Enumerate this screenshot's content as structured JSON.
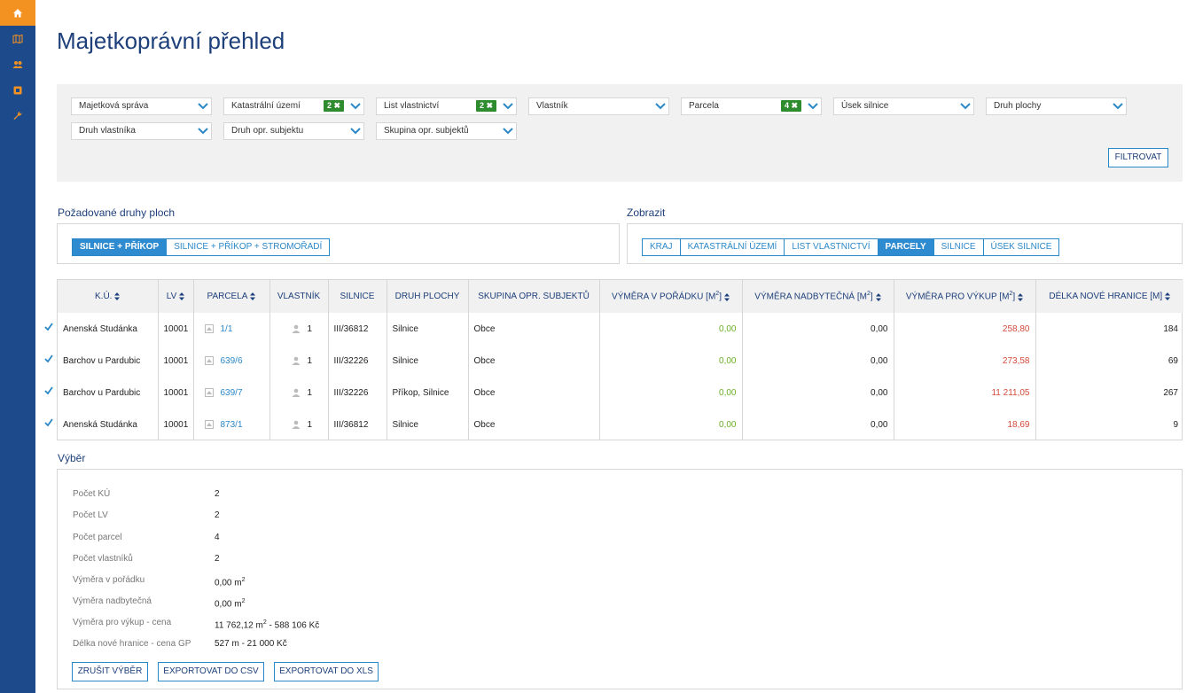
{
  "page": {
    "title": "Majetkoprávní přehled"
  },
  "sidebar": {
    "items": [
      {
        "icon": "home-icon",
        "active": true
      },
      {
        "icon": "map-icon",
        "active": false
      },
      {
        "icon": "users-icon",
        "active": false
      },
      {
        "icon": "record-icon",
        "active": false
      },
      {
        "icon": "wrench-icon",
        "active": false
      }
    ]
  },
  "filters": {
    "row1": [
      {
        "label": "Majetková správa",
        "badge": ""
      },
      {
        "label": "Katastrální území",
        "badge": "2 ✖"
      },
      {
        "label": "List vlastnictví",
        "badge": "2 ✖"
      },
      {
        "label": "Vlastník",
        "badge": ""
      },
      {
        "label": "Parcela",
        "badge": "4 ✖"
      },
      {
        "label": "Úsek silnice",
        "badge": ""
      },
      {
        "label": "Druh plochy",
        "badge": ""
      }
    ],
    "row2": [
      {
        "label": "Druh vlastníka",
        "badge": ""
      },
      {
        "label": "Druh opr. subjektu",
        "badge": ""
      },
      {
        "label": "Skupina opr. subjektů",
        "badge": ""
      }
    ],
    "filter_button": "FILTROVAT"
  },
  "surface_types": {
    "title": "Požadované druhy ploch",
    "options": [
      "SILNICE + PŘÍKOP",
      "SILNICE + PŘÍKOP + STROMOŘADÍ"
    ],
    "selected": 0
  },
  "display": {
    "title": "Zobrazit",
    "options": [
      "KRAJ",
      "KATASTRÁLNÍ ÚZEMÍ",
      "LIST VLASTNICTVÍ",
      "PARCELY",
      "SILNICE",
      "ÚSEK SILNICE"
    ],
    "selected": 3
  },
  "table": {
    "headers": {
      "ku": "K.Ú.",
      "lv": "LV",
      "parcela": "PARCELA",
      "vlastnik": "VLASTNÍK",
      "silnice": "SILNICE",
      "druh": "DRUH PLOCHY",
      "skupina": "SKUPINA OPR. SUBJEKTŮ",
      "vymera_poradek": "VÝMĚRA V POŘÁDKU [m",
      "vymera_nadbyt": "VÝMĚRA NADBYTEČNÁ [m",
      "vymera_vykup": "VÝMĚRA PRO VÝKUP [m",
      "delka": "DÉLKA NOVÉ HRANICE [m]",
      "sq": "2",
      "close": "]"
    },
    "rows": [
      {
        "ku": "Anenská Studánka",
        "lv": "10001",
        "parcela": "1/1",
        "vlastnik": "1",
        "silnice": "III/36812",
        "druh": "Silnice",
        "skupina": "Obce",
        "v1": "0,00",
        "v2": "0,00",
        "v3": "258,80",
        "delka": "184"
      },
      {
        "ku": "Barchov u Pardubic",
        "lv": "10001",
        "parcela": "639/6",
        "vlastnik": "1",
        "silnice": "III/32226",
        "druh": "Silnice",
        "skupina": "Obce",
        "v1": "0,00",
        "v2": "0,00",
        "v3": "273,58",
        "delka": "69"
      },
      {
        "ku": "Barchov u Pardubic",
        "lv": "10001",
        "parcela": "639/7",
        "vlastnik": "1",
        "silnice": "III/32226",
        "druh": "Příkop, Silnice",
        "skupina": "Obce",
        "v1": "0,00",
        "v2": "0,00",
        "v3": "11 211,05",
        "delka": "267"
      },
      {
        "ku": "Anenská Studánka",
        "lv": "10001",
        "parcela": "873/1",
        "vlastnik": "1",
        "silnice": "III/36812",
        "druh": "Silnice",
        "skupina": "Obce",
        "v1": "0,00",
        "v2": "0,00",
        "v3": "18,69",
        "delka": "9"
      }
    ]
  },
  "selection": {
    "title": "Výběr",
    "rows": [
      {
        "k": "Počet KÚ",
        "v": "2"
      },
      {
        "k": "Počet LV",
        "v": "2"
      },
      {
        "k": "Počet parcel",
        "v": "4"
      },
      {
        "k": "Počet vlastníků",
        "v": "2"
      },
      {
        "k": "Výměra v pořádku",
        "v": "0,00 m",
        "sup": "2"
      },
      {
        "k": "Výměra nadbytečná",
        "v": "0,00 m",
        "sup": "2"
      },
      {
        "k": "Výměra pro výkup - cena",
        "v": "11 762,12 m",
        "sup": "2",
        "tail": " - 588 106 Kč"
      },
      {
        "k": "Délka nové hranice - cena GP",
        "v": "527 m - 21 000 Kč"
      }
    ],
    "buttons": {
      "cancel": "ZRUŠIT VÝBĚR",
      "csv": "EXPORTOVAT DO CSV",
      "xls": "EXPORTOVAT DO XLS"
    }
  },
  "colors": {
    "accent": "#2a88c8",
    "sidebar": "#1d4a8b",
    "active": "#f39221",
    "green": "#6ab023",
    "red": "#d34a3a",
    "badge": "#2e8b2e"
  }
}
